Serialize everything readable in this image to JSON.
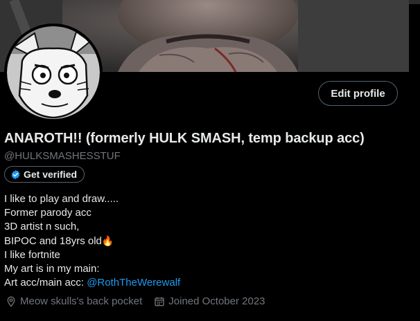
{
  "profile": {
    "display_name": "ANAROTH!! (formerly HULK SMASH, temp backup acc)",
    "handle": "@HULKSMASHESSTUF",
    "verify_label": "Get verified",
    "edit_profile_label": "Edit profile"
  },
  "bio": {
    "lines": [
      "I like to play and draw.....",
      "Former parody acc",
      "3D artist n such,",
      "BIPOC and 18yrs old",
      "I like fortnite",
      "My art is in my main:"
    ],
    "emoji": "🔥",
    "link_prefix": "Art acc/main acc: ",
    "link_text": "@RothTheWerewalf"
  },
  "meta": {
    "location": "Meow skulls's back pocket",
    "joined": "Joined October 2023",
    "location_icon": "location-pin-icon",
    "calendar_icon": "calendar-icon"
  },
  "colors": {
    "background": "#000000",
    "text": "#e7e9ea",
    "muted": "#71767b",
    "link": "#1d9bf0",
    "border": "#536471"
  }
}
